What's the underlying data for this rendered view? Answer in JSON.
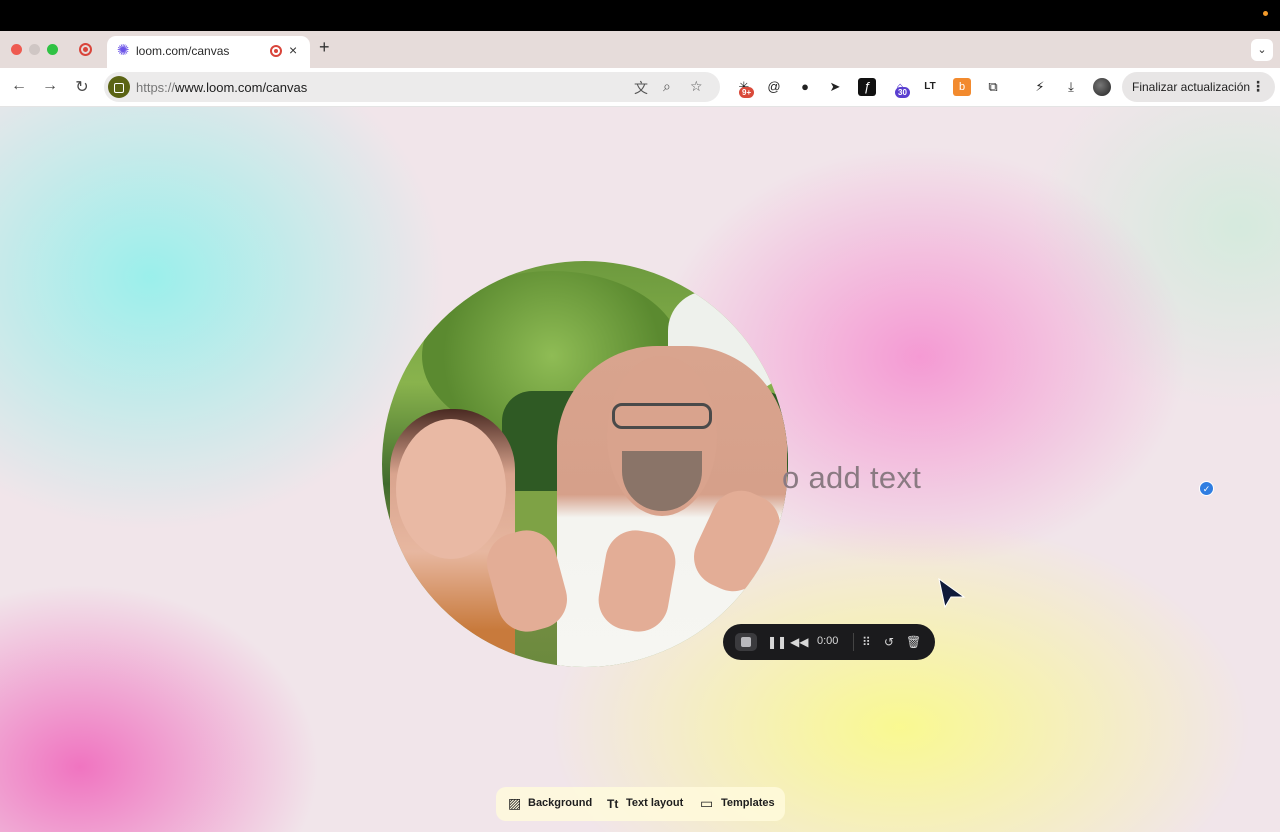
{
  "browser": {
    "tab_title": "loom.com/canvas",
    "new_tab_symbol": "+",
    "close_symbol": "×",
    "tab_menu_symbol": "⌄",
    "url_scheme": "https://",
    "url_host_path": "www.loom.com/canvas",
    "update_button_label": "Finalizar actualización",
    "extensions": [
      {
        "name": "ext-badge-icon",
        "badge": "9+"
      },
      {
        "name": "ext-at-icon"
      },
      {
        "name": "ext-colorful-icon"
      },
      {
        "name": "ext-pointer-icon"
      },
      {
        "name": "ext-fx-icon"
      },
      {
        "name": "ext-house-icon",
        "badge": "30"
      },
      {
        "name": "ext-lt-icon"
      },
      {
        "name": "ext-hubspot-icon"
      },
      {
        "name": "extensions-puzzle-icon"
      }
    ]
  },
  "canvas": {
    "text_placeholder": "o add text",
    "recorder": {
      "time": "0:00"
    },
    "bottom_menu": {
      "background_label": "Background",
      "text_layout_label": "Text layout",
      "templates_label": "Templates"
    }
  },
  "colors": {
    "recording_red": "#d9453b",
    "recorder_bg": "#1b1b1d",
    "check_blue": "#2f7de1"
  }
}
